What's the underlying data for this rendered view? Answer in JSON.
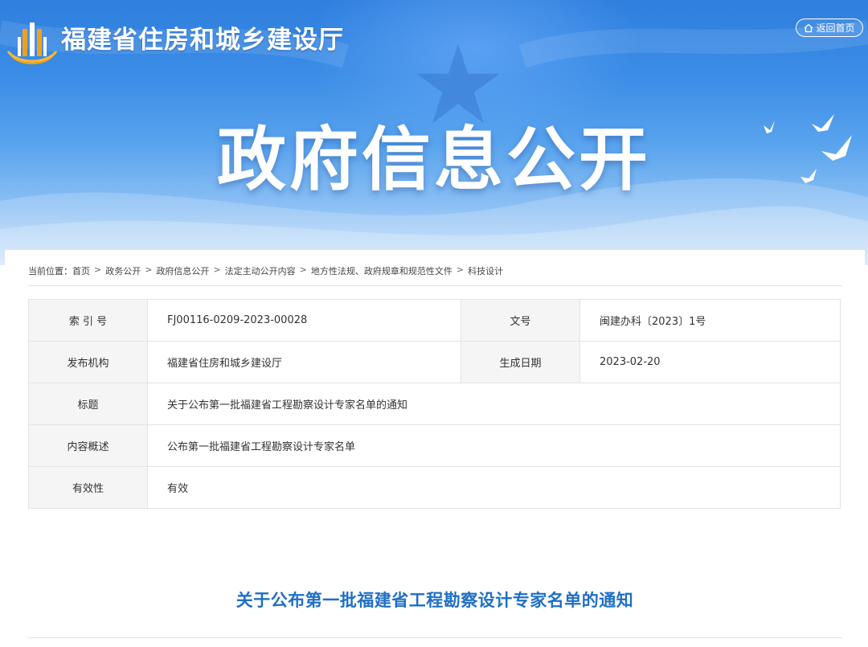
{
  "header": {
    "site_name": "福建省住房和城乡建设厅",
    "back_home_label": "返回首页",
    "banner_title": "政府信息公开"
  },
  "breadcrumb": {
    "prefix": "当前位置：",
    "items": [
      "首页",
      "政务公开",
      "政府信息公开",
      "法定主动公开内容",
      "地方性法规、政府规章和规范性文件",
      "科技设计"
    ],
    "separator": ">"
  },
  "info": {
    "index_label": "索 引 号",
    "index_value": "FJ00116-0209-2023-00028",
    "docno_label": "文号",
    "docno_value": "闽建办科〔2023〕1号",
    "publisher_label": "发布机构",
    "publisher_value": "福建省住房和城乡建设厅",
    "date_label": "生成日期",
    "date_value": "2023-02-20",
    "title_label": "标题",
    "title_value": "关于公布第一批福建省工程勘察设计专家名单的通知",
    "summary_label": "内容概述",
    "summary_value": "公布第一批福建省工程勘察设计专家名单",
    "validity_label": "有效性",
    "validity_value": "有效"
  },
  "article": {
    "title": "关于公布第一批福建省工程勘察设计专家名单的通知"
  },
  "colors": {
    "banner_top": "#2f7fde",
    "banner_bottom": "#c9e0fa",
    "article_title": "#1f6fc4",
    "logo_orange": "#f0a020"
  },
  "icons": {
    "logo": "building-emblem-icon",
    "home": "home-icon",
    "doves": "dove-icon",
    "banner_star": "star-icon"
  }
}
